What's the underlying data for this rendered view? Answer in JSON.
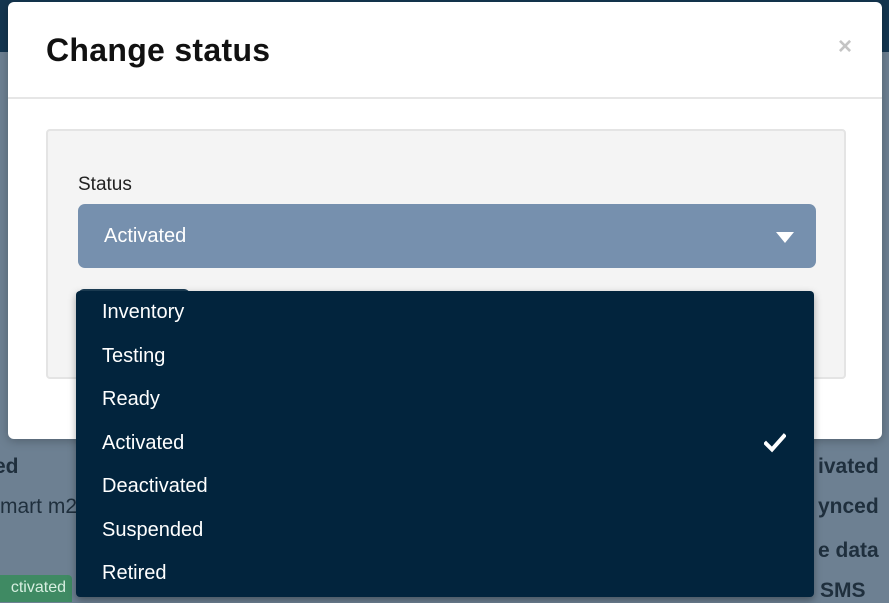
{
  "background": {
    "fragments": {
      "left_1": "ed",
      "left_2": "mart m2",
      "right_1": "ivated",
      "right_2": "ynced",
      "right_3": "e data",
      "right_4": "SMS",
      "badge": "ctivated"
    }
  },
  "modal": {
    "title": "Change status",
    "close_label": "×",
    "status_field": {
      "label": "Status",
      "selected": "Activated"
    },
    "options": [
      {
        "label": "Inventory",
        "selected": false
      },
      {
        "label": "Testing",
        "selected": false
      },
      {
        "label": "Ready",
        "selected": false
      },
      {
        "label": "Activated",
        "selected": true
      },
      {
        "label": "Deactivated",
        "selected": false
      },
      {
        "label": "Suspended",
        "selected": false
      },
      {
        "label": "Retired",
        "selected": false
      }
    ],
    "icons": {
      "selected_option": "check-icon",
      "close": "close-icon",
      "select": "caret-down-icon"
    }
  },
  "colors": {
    "select_bg": "#7690ae",
    "dropdown_bg": "#02243d",
    "overlay": "#6d8092"
  }
}
